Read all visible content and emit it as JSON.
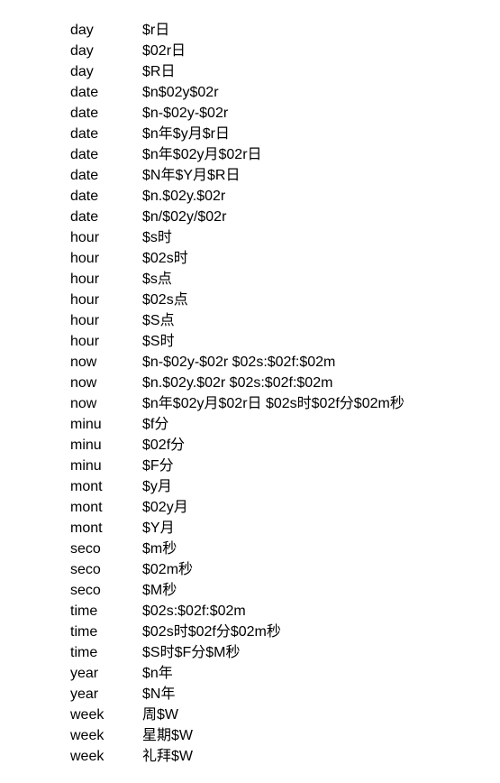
{
  "rows": [
    {
      "key": "day",
      "format": "$r日"
    },
    {
      "key": "day",
      "format": "$02r日"
    },
    {
      "key": "day",
      "format": "$R日"
    },
    {
      "key": "date",
      "format": "$n$02y$02r"
    },
    {
      "key": "date",
      "format": "$n-$02y-$02r"
    },
    {
      "key": "date",
      "format": "$n年$y月$r日"
    },
    {
      "key": "date",
      "format": "$n年$02y月$02r日"
    },
    {
      "key": "date",
      "format": "$N年$Y月$R日"
    },
    {
      "key": "date",
      "format": "$n.$02y.$02r"
    },
    {
      "key": "date",
      "format": "$n/$02y/$02r"
    },
    {
      "key": "hour",
      "format": "$s时"
    },
    {
      "key": "hour",
      "format": "$02s时"
    },
    {
      "key": "hour",
      "format": "$s点"
    },
    {
      "key": "hour",
      "format": "$02s点"
    },
    {
      "key": "hour",
      "format": "$S点"
    },
    {
      "key": "hour",
      "format": "$S时"
    },
    {
      "key": "now",
      "format": "$n-$02y-$02r $02s:$02f:$02m"
    },
    {
      "key": "now",
      "format": "$n.$02y.$02r $02s:$02f:$02m"
    },
    {
      "key": "now",
      "format": "$n年$02y月$02r日 $02s时$02f分$02m秒"
    },
    {
      "key": "minu",
      "format": "$f分"
    },
    {
      "key": "minu",
      "format": "$02f分"
    },
    {
      "key": "minu",
      "format": "$F分"
    },
    {
      "key": "mont",
      "format": "$y月"
    },
    {
      "key": "mont",
      "format": "$02y月"
    },
    {
      "key": "mont",
      "format": "$Y月"
    },
    {
      "key": "seco",
      "format": "$m秒"
    },
    {
      "key": "seco",
      "format": "$02m秒"
    },
    {
      "key": "seco",
      "format": "$M秒"
    },
    {
      "key": "time",
      "format": "$02s:$02f:$02m"
    },
    {
      "key": "time",
      "format": "$02s时$02f分$02m秒"
    },
    {
      "key": "time",
      "format": "$S时$F分$M秒"
    },
    {
      "key": "year",
      "format": "$n年"
    },
    {
      "key": "year",
      "format": "$N年"
    },
    {
      "key": "week",
      "format": "周$W"
    },
    {
      "key": "week",
      "format": "星期$W"
    },
    {
      "key": "week",
      "format": "礼拜$W"
    }
  ]
}
